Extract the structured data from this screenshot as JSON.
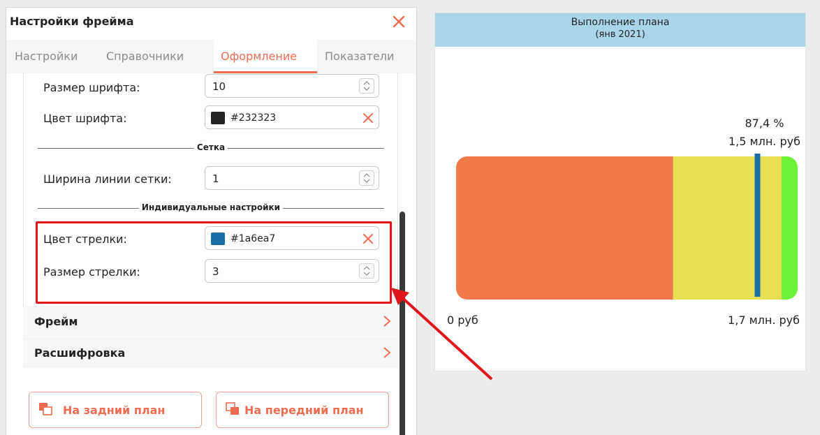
{
  "panel": {
    "title": "Настройки фрейма",
    "close_icon": "close-icon"
  },
  "tabs": [
    {
      "label": "Настройки",
      "active": false
    },
    {
      "label": "Справочники",
      "active": false
    },
    {
      "label": "Оформление",
      "active": true
    },
    {
      "label": "Показатели",
      "active": false
    }
  ],
  "settings": {
    "font_size": {
      "label": "Размер шрифта:",
      "value": "10"
    },
    "font_color": {
      "label": "Цвет шрифта:",
      "value": "#232323",
      "swatch": "#232323"
    },
    "grid_section": "Сетка",
    "grid_line_width": {
      "label": "Ширина линии сетки:",
      "value": "1"
    },
    "individual_section": "Индивидуальные настройки",
    "arrow_color": {
      "label": "Цвет стрелки:",
      "value": "#1a6ea7",
      "swatch": "#1a6ea7"
    },
    "arrow_size": {
      "label": "Размер стрелки:",
      "value": "3"
    }
  },
  "groups": {
    "frame": "Фрейм",
    "drilldown": "Расшифровка"
  },
  "buttons": {
    "send_back": "На задний план",
    "bring_front": "На передний план"
  },
  "colors": {
    "accent": "#ef6c50",
    "highlight": "#e2161a",
    "header_bg": "#a8d6e8"
  },
  "chart": {
    "title": "Выполнение плана",
    "subtitle": "(янв 2021)",
    "percent_label": "87,4 %",
    "value_label": "1,5 млн. руб",
    "min_label": "0 руб",
    "max_label": "1,7 млн. руб"
  },
  "chart_data": {
    "type": "bar",
    "orientation": "horizontal-bullet",
    "title": "Выполнение плана",
    "subtitle": "(янв 2021)",
    "min": 0,
    "max": 1.7,
    "unit": "млн. руб",
    "bands": [
      {
        "from": 0,
        "to": 1.08,
        "color": "#f17a4b"
      },
      {
        "from": 1.08,
        "to": 1.62,
        "color": "#e5e150"
      },
      {
        "from": 1.62,
        "to": 1.7,
        "color": "#6df23a"
      }
    ],
    "marker": {
      "value": 1.5,
      "percent": 87.4,
      "color": "#1a6ea7"
    }
  }
}
